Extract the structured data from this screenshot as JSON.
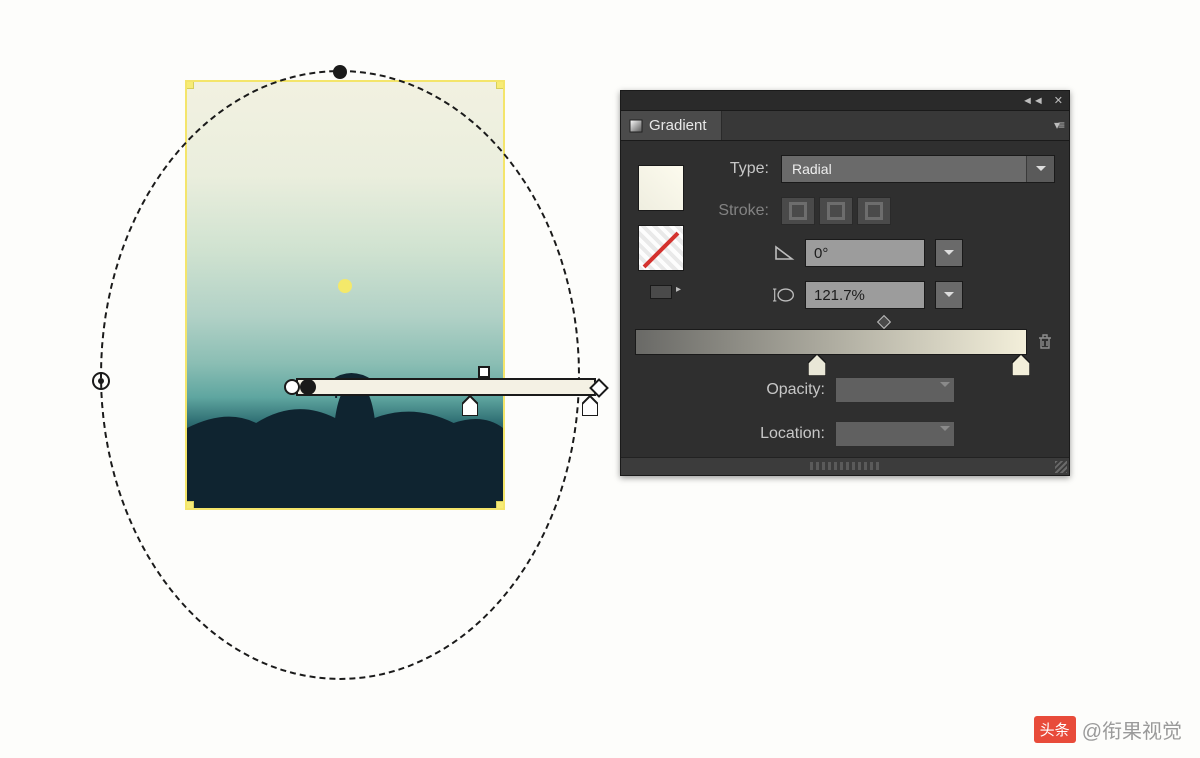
{
  "panel": {
    "tab_label": "Gradient",
    "type_label": "Type:",
    "type_value": "Radial",
    "stroke_label": "Stroke:",
    "angle_value": "0°",
    "aspect_value": "121.7%",
    "opacity_label": "Opacity:",
    "opacity_value": "",
    "location_label": "Location:",
    "location_value": "",
    "stops": [
      {
        "position_pct": 44,
        "color": "#f0eedd"
      },
      {
        "position_pct": 100,
        "color": "#f3efda"
      }
    ],
    "midpoint_pct": 58
  },
  "artboard": {
    "selection_color": "#f4e56b"
  },
  "icons": {
    "collapse": "◄◄",
    "close": "✕",
    "menu": "▾≡",
    "trash": "trash-icon",
    "angle": "angle-icon",
    "aspect": "aspect-icon",
    "gradient_tab": "gradient-tab-icon"
  },
  "watermark": {
    "badge": "头条",
    "text": "@衔果视觉"
  }
}
